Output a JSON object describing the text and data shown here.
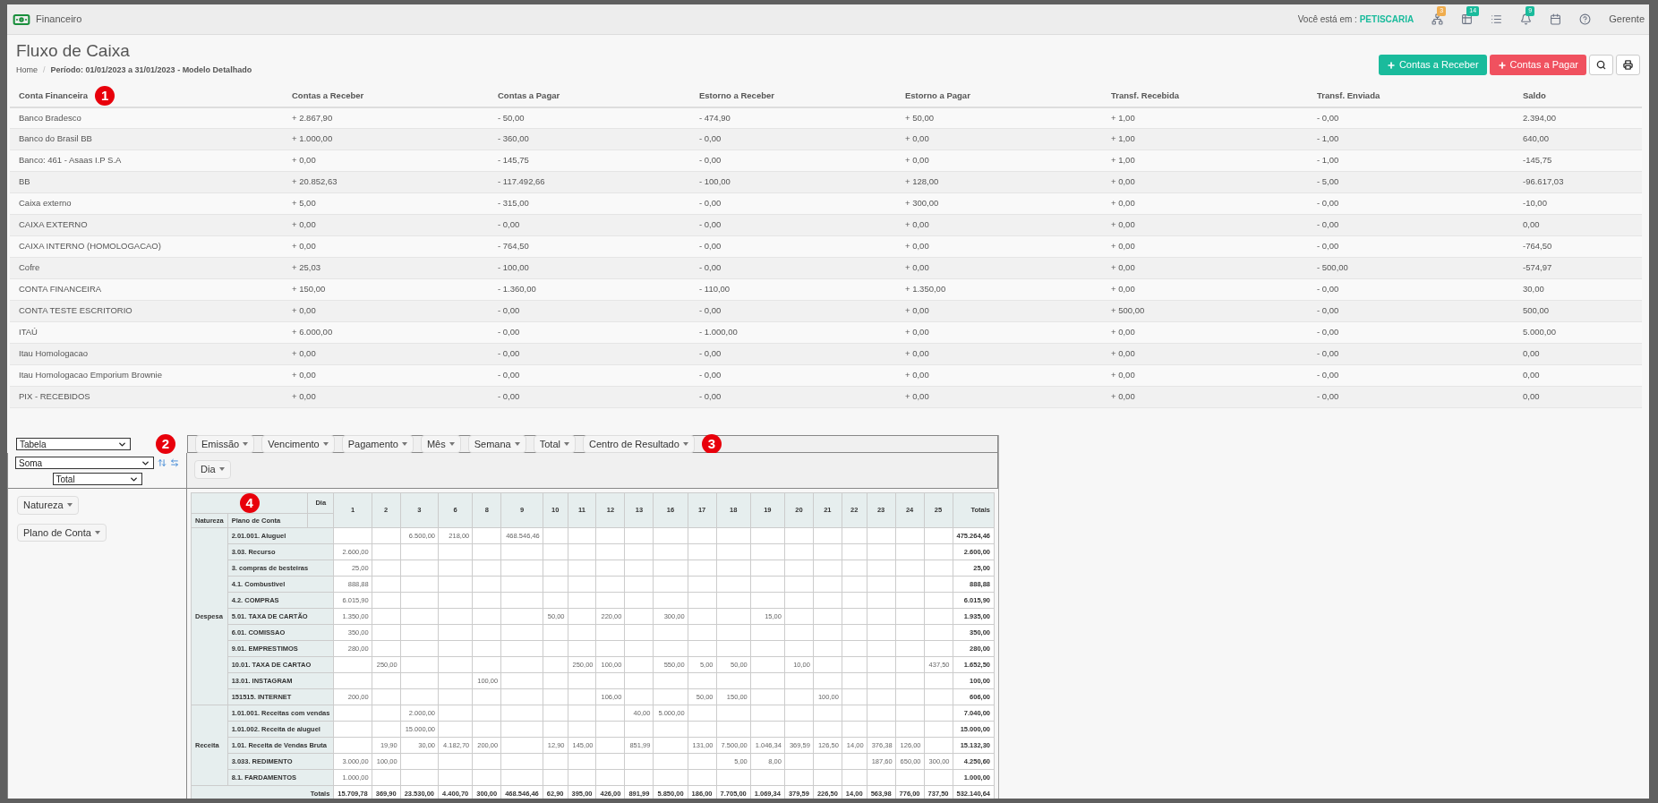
{
  "app_bar": {
    "module": "Financeiro",
    "location_label": "Você está em :",
    "location": "PETISCARIA",
    "icons": [
      {
        "kind": "sitemap",
        "badge": "3",
        "color": "#f0ad4e"
      },
      {
        "kind": "table",
        "badge": "14",
        "color": "#1abb9c"
      },
      {
        "kind": "list"
      },
      {
        "kind": "bell",
        "badge": "9",
        "color": "#1abb9c"
      },
      {
        "kind": "calendar"
      },
      {
        "kind": "help"
      }
    ],
    "user": "Gerente"
  },
  "page": {
    "title": "Fluxo de Caixa",
    "breadcrumb": {
      "home": "Home",
      "separator": "/",
      "current": "Período: 01/01/2023 a 31/01/2023 - Modelo Detalhado"
    },
    "buttons": [
      {
        "kind": "receive",
        "label": "Contas a Receber"
      },
      {
        "kind": "pay",
        "label": "Contas a Pagar"
      },
      {
        "kind": "search"
      },
      {
        "kind": "print"
      }
    ]
  },
  "markers": [
    "1",
    "2",
    "3",
    "4"
  ],
  "summary_table": {
    "columns": [
      "Conta Financeira",
      "Contas a Receber",
      "Contas a Pagar",
      "Estorno a Receber",
      "Estorno a Pagar",
      "Transf. Recebida",
      "Transf. Enviada",
      "Saldo"
    ],
    "rows": [
      [
        "Banco Bradesco",
        "+ 2.867,90",
        "- 50,00",
        "- 474,90",
        "+ 50,00",
        "+ 1,00",
        "- 0,00",
        "2.394,00"
      ],
      [
        "Banco do Brasil BB",
        "+ 1.000,00",
        "- 360,00",
        "- 0,00",
        "+ 0,00",
        "+ 1,00",
        "- 1,00",
        "640,00"
      ],
      [
        "Banco: 461 - Asaas I.P S.A",
        "+ 0,00",
        "- 145,75",
        "- 0,00",
        "+ 0,00",
        "+ 1,00",
        "- 1,00",
        "-145,75"
      ],
      [
        "BB",
        "+ 20.852,63",
        "- 117.492,66",
        "- 100,00",
        "+ 128,00",
        "+ 0,00",
        "- 5,00",
        "-96.617,03"
      ],
      [
        "Caixa externo",
        "+ 5,00",
        "- 315,00",
        "- 0,00",
        "+ 300,00",
        "+ 0,00",
        "- 0,00",
        "-10,00"
      ],
      [
        "CAIXA EXTERNO",
        "+ 0,00",
        "- 0,00",
        "- 0,00",
        "+ 0,00",
        "+ 0,00",
        "- 0,00",
        "0,00"
      ],
      [
        "CAIXA INTERNO (HOMOLOGACAO)",
        "+ 0,00",
        "- 764,50",
        "- 0,00",
        "+ 0,00",
        "+ 0,00",
        "- 0,00",
        "-764,50"
      ],
      [
        "Cofre",
        "+ 25,03",
        "- 100,00",
        "- 0,00",
        "+ 0,00",
        "+ 0,00",
        "- 500,00",
        "-574,97"
      ],
      [
        "CONTA FINANCEIRA",
        "+ 150,00",
        "- 1.360,00",
        "- 110,00",
        "+ 1.350,00",
        "+ 0,00",
        "- 0,00",
        "30,00"
      ],
      [
        "CONTA TESTE ESCRITORIO",
        "+ 0,00",
        "- 0,00",
        "- 0,00",
        "+ 0,00",
        "+ 500,00",
        "- 0,00",
        "500,00"
      ],
      [
        "ITAÚ",
        "+ 6.000,00",
        "- 0,00",
        "- 1.000,00",
        "+ 0,00",
        "+ 0,00",
        "- 0,00",
        "5.000,00"
      ],
      [
        "Itau Homologacao",
        "+ 0,00",
        "- 0,00",
        "- 0,00",
        "+ 0,00",
        "+ 0,00",
        "- 0,00",
        "0,00"
      ],
      [
        "Itau Homologacao Emporium Brownie",
        "+ 0,00",
        "- 0,00",
        "- 0,00",
        "+ 0,00",
        "+ 0,00",
        "- 0,00",
        "0,00"
      ],
      [
        "PIX - RECEBIDOS",
        "+ 0,00",
        "- 0,00",
        "- 0,00",
        "+ 0,00",
        "+ 0,00",
        "- 0,00",
        "0,00"
      ]
    ]
  },
  "pivot": {
    "renderer": "Tabela",
    "aggregator": "Soma",
    "value_field": "Total",
    "unused_fields": [
      "Emissão",
      "Vencimento",
      "Pagamento",
      "Mês",
      "Semana",
      "Total",
      "Centro de Resultado"
    ],
    "col_fields": [
      "Dia"
    ],
    "row_fields": [
      "Natureza",
      "Plano de Conta"
    ],
    "table": {
      "col_attr": "Dia",
      "row_attrs": [
        "Natureza",
        "Plano de Conta"
      ],
      "totals_header": "Totals",
      "columns": [
        "1",
        "2",
        "3",
        "6",
        "8",
        "9",
        "10",
        "11",
        "12",
        "13",
        "16",
        "17",
        "18",
        "19",
        "20",
        "21",
        "22",
        "23",
        "24",
        "25"
      ],
      "groups": [
        {
          "label": "Despesa",
          "rows": [
            {
              "label": "2.01.001. Aluguel",
              "cells": [
                {
                  "empty": true
                },
                {
                  "empty": true
                },
                {
                  "value": "6.500,00"
                },
                {
                  "value": "218,00"
                },
                {
                  "empty": true
                },
                {
                  "value": "468.546,46"
                },
                {
                  "empty": true
                },
                {
                  "empty": true
                },
                {
                  "empty": true
                },
                {
                  "empty": true
                },
                {
                  "empty": true
                },
                {
                  "empty": true
                },
                {
                  "empty": true
                },
                {
                  "empty": true
                },
                {
                  "empty": true
                },
                {
                  "empty": true
                },
                {
                  "empty": true
                },
                {
                  "empty": true
                },
                {
                  "empty": true
                },
                {
                  "empty": true
                }
              ],
              "total": "475.264,46"
            },
            {
              "label": "3.03. Recurso",
              "cells": [
                {
                  "value": "2.600,00"
                },
                {
                  "empty": true
                },
                {
                  "empty": true
                },
                {
                  "empty": true
                },
                {
                  "empty": true
                },
                {
                  "empty": true
                },
                {
                  "empty": true
                },
                {
                  "empty": true
                },
                {
                  "empty": true
                },
                {
                  "empty": true
                },
                {
                  "empty": true
                },
                {
                  "empty": true
                },
                {
                  "empty": true
                },
                {
                  "empty": true
                },
                {
                  "empty": true
                },
                {
                  "empty": true
                },
                {
                  "empty": true
                },
                {
                  "empty": true
                },
                {
                  "empty": true
                },
                {
                  "empty": true
                }
              ],
              "total": "2.600,00"
            },
            {
              "label": "3. compras de besteiras",
              "cells": [
                {
                  "value": "25,00"
                },
                {
                  "empty": true
                },
                {
                  "empty": true
                },
                {
                  "empty": true
                },
                {
                  "empty": true
                },
                {
                  "empty": true
                },
                {
                  "empty": true
                },
                {
                  "empty": true
                },
                {
                  "empty": true
                },
                {
                  "empty": true
                },
                {
                  "empty": true
                },
                {
                  "empty": true
                },
                {
                  "empty": true
                },
                {
                  "empty": true
                },
                {
                  "empty": true
                },
                {
                  "empty": true
                },
                {
                  "empty": true
                },
                {
                  "empty": true
                },
                {
                  "empty": true
                },
                {
                  "empty": true
                }
              ],
              "total": "25,00"
            },
            {
              "label": "4.1. Combustivel",
              "cells": [
                {
                  "value": "888,88"
                },
                {
                  "empty": true
                },
                {
                  "empty": true
                },
                {
                  "empty": true
                },
                {
                  "empty": true
                },
                {
                  "empty": true
                },
                {
                  "empty": true
                },
                {
                  "empty": true
                },
                {
                  "empty": true
                },
                {
                  "empty": true
                },
                {
                  "empty": true
                },
                {
                  "empty": true
                },
                {
                  "empty": true
                },
                {
                  "empty": true
                },
                {
                  "empty": true
                },
                {
                  "empty": true
                },
                {
                  "empty": true
                },
                {
                  "empty": true
                },
                {
                  "empty": true
                },
                {
                  "empty": true
                }
              ],
              "total": "888,88"
            },
            {
              "label": "4.2. COMPRAS",
              "cells": [
                {
                  "value": "6.015,90"
                },
                {
                  "empty": true
                },
                {
                  "empty": true
                },
                {
                  "empty": true
                },
                {
                  "empty": true
                },
                {
                  "empty": true
                },
                {
                  "empty": true
                },
                {
                  "empty": true
                },
                {
                  "empty": true
                },
                {
                  "empty": true
                },
                {
                  "empty": true
                },
                {
                  "empty": true
                },
                {
                  "empty": true
                },
                {
                  "empty": true
                },
                {
                  "empty": true
                },
                {
                  "empty": true
                },
                {
                  "empty": true
                },
                {
                  "empty": true
                },
                {
                  "empty": true
                },
                {
                  "empty": true
                }
              ],
              "total": "6.015,90"
            },
            {
              "label": "5.01. TAXA DE CARTÃO",
              "cells": [
                {
                  "value": "1.350,00"
                },
                {
                  "empty": true
                },
                {
                  "empty": true
                },
                {
                  "empty": true
                },
                {
                  "empty": true
                },
                {
                  "empty": true
                },
                {
                  "value": "50,00"
                },
                {
                  "empty": true
                },
                {
                  "value": "220,00"
                },
                {
                  "empty": true
                },
                {
                  "value": "300,00"
                },
                {
                  "empty": true
                },
                {
                  "empty": true
                },
                {
                  "value": "15,00"
                },
                {
                  "empty": true
                },
                {
                  "empty": true
                },
                {
                  "empty": true
                },
                {
                  "empty": true
                },
                {
                  "empty": true
                },
                {
                  "empty": true
                }
              ],
              "total": "1.935,00"
            },
            {
              "label": "6.01. COMISSAO",
              "cells": [
                {
                  "value": "350,00"
                },
                {
                  "empty": true
                },
                {
                  "empty": true
                },
                {
                  "empty": true
                },
                {
                  "empty": true
                },
                {
                  "empty": true
                },
                {
                  "empty": true
                },
                {
                  "empty": true
                },
                {
                  "empty": true
                },
                {
                  "empty": true
                },
                {
                  "empty": true
                },
                {
                  "empty": true
                },
                {
                  "empty": true
                },
                {
                  "empty": true
                },
                {
                  "empty": true
                },
                {
                  "empty": true
                },
                {
                  "empty": true
                },
                {
                  "empty": true
                },
                {
                  "empty": true
                },
                {
                  "empty": true
                }
              ],
              "total": "350,00"
            },
            {
              "label": "9.01. EMPRESTIMOS",
              "cells": [
                {
                  "value": "280,00"
                },
                {
                  "empty": true
                },
                {
                  "empty": true
                },
                {
                  "empty": true
                },
                {
                  "empty": true
                },
                {
                  "empty": true
                },
                {
                  "empty": true
                },
                {
                  "empty": true
                },
                {
                  "empty": true
                },
                {
                  "empty": true
                },
                {
                  "empty": true
                },
                {
                  "empty": true
                },
                {
                  "empty": true
                },
                {
                  "empty": true
                },
                {
                  "empty": true
                },
                {
                  "empty": true
                },
                {
                  "empty": true
                },
                {
                  "empty": true
                },
                {
                  "empty": true
                },
                {
                  "empty": true
                }
              ],
              "total": "280,00"
            },
            {
              "label": "10.01. TAXA DE CARTAO",
              "cells": [
                {
                  "empty": true
                },
                {
                  "value": "250,00"
                },
                {
                  "empty": true
                },
                {
                  "empty": true
                },
                {
                  "empty": true
                },
                {
                  "empty": true
                },
                {
                  "empty": true
                },
                {
                  "value": "250,00"
                },
                {
                  "value": "100,00"
                },
                {
                  "empty": true
                },
                {
                  "value": "550,00"
                },
                {
                  "value": "5,00"
                },
                {
                  "value": "50,00"
                },
                {
                  "empty": true
                },
                {
                  "value": "10,00"
                },
                {
                  "empty": true
                },
                {
                  "empty": true
                },
                {
                  "empty": true
                },
                {
                  "empty": true
                },
                {
                  "value": "437,50"
                }
              ],
              "total": "1.652,50"
            },
            {
              "label": "13.01. INSTAGRAM",
              "cells": [
                {
                  "empty": true
                },
                {
                  "empty": true
                },
                {
                  "empty": true
                },
                {
                  "empty": true
                },
                {
                  "value": "100,00"
                },
                {
                  "empty": true
                },
                {
                  "empty": true
                },
                {
                  "empty": true
                },
                {
                  "empty": true
                },
                {
                  "empty": true
                },
                {
                  "empty": true
                },
                {
                  "empty": true
                },
                {
                  "empty": true
                },
                {
                  "empty": true
                },
                {
                  "empty": true
                },
                {
                  "empty": true
                },
                {
                  "empty": true
                },
                {
                  "empty": true
                },
                {
                  "empty": true
                },
                {
                  "empty": true
                }
              ],
              "total": "100,00"
            },
            {
              "label": "151515. INTERNET",
              "cells": [
                {
                  "value": "200,00"
                },
                {
                  "empty": true
                },
                {
                  "empty": true
                },
                {
                  "empty": true
                },
                {
                  "empty": true
                },
                {
                  "empty": true
                },
                {
                  "empty": true
                },
                {
                  "empty": true
                },
                {
                  "value": "106,00"
                },
                {
                  "empty": true
                },
                {
                  "empty": true
                },
                {
                  "value": "50,00"
                },
                {
                  "value": "150,00"
                },
                {
                  "empty": true
                },
                {
                  "empty": true
                },
                {
                  "value": "100,00"
                },
                {
                  "empty": true
                },
                {
                  "empty": true
                },
                {
                  "empty": true
                },
                {
                  "empty": true
                }
              ],
              "total": "606,00"
            }
          ]
        },
        {
          "label": "Receita",
          "rows": [
            {
              "label": "1.01.001. Receitas com vendas",
              "cells": [
                {
                  "empty": true
                },
                {
                  "empty": true
                },
                {
                  "value": "2.000,00"
                },
                {
                  "empty": true
                },
                {
                  "empty": true
                },
                {
                  "empty": true
                },
                {
                  "empty": true
                },
                {
                  "empty": true
                },
                {
                  "empty": true
                },
                {
                  "value": "40,00"
                },
                {
                  "value": "5.000,00"
                },
                {
                  "empty": true
                },
                {
                  "empty": true
                },
                {
                  "empty": true
                },
                {
                  "empty": true
                },
                {
                  "empty": true
                },
                {
                  "empty": true
                },
                {
                  "empty": true
                },
                {
                  "empty": true
                },
                {
                  "empty": true
                }
              ],
              "total": "7.040,00"
            },
            {
              "label": "1.01.002. Receita de aluguel",
              "cells": [
                {
                  "empty": true
                },
                {
                  "empty": true
                },
                {
                  "value": "15.000,00"
                },
                {
                  "empty": true
                },
                {
                  "empty": true
                },
                {
                  "empty": true
                },
                {
                  "empty": true
                },
                {
                  "empty": true
                },
                {
                  "empty": true
                },
                {
                  "empty": true
                },
                {
                  "empty": true
                },
                {
                  "empty": true
                },
                {
                  "empty": true
                },
                {
                  "empty": true
                },
                {
                  "empty": true
                },
                {
                  "empty": true
                },
                {
                  "empty": true
                },
                {
                  "empty": true
                },
                {
                  "empty": true
                },
                {
                  "empty": true
                }
              ],
              "total": "15.000,00"
            },
            {
              "label": "1.01. Receita de Vendas Bruta",
              "cells": [
                {
                  "empty": true
                },
                {
                  "value": "19,90"
                },
                {
                  "value": "30,00"
                },
                {
                  "value": "4.182,70"
                },
                {
                  "value": "200,00"
                },
                {
                  "empty": true
                },
                {
                  "value": "12,90"
                },
                {
                  "value": "145,00"
                },
                {
                  "empty": true
                },
                {
                  "value": "851,99"
                },
                {
                  "empty": true
                },
                {
                  "value": "131,00"
                },
                {
                  "value": "7.500,00"
                },
                {
                  "value": "1.046,34"
                },
                {
                  "value": "369,59"
                },
                {
                  "value": "126,50"
                },
                {
                  "value": "14,00"
                },
                {
                  "value": "376,38"
                },
                {
                  "value": "126,00"
                },
                {
                  "empty": true
                }
              ],
              "total": "15.132,30"
            },
            {
              "label": "3.033. REDIMENTO",
              "cells": [
                {
                  "value": "3.000,00"
                },
                {
                  "value": "100,00"
                },
                {
                  "empty": true
                },
                {
                  "empty": true
                },
                {
                  "empty": true
                },
                {
                  "empty": true
                },
                {
                  "empty": true
                },
                {
                  "empty": true
                },
                {
                  "empty": true
                },
                {
                  "empty": true
                },
                {
                  "empty": true
                },
                {
                  "empty": true
                },
                {
                  "value": "5,00"
                },
                {
                  "value": "8,00"
                },
                {
                  "empty": true
                },
                {
                  "empty": true
                },
                {
                  "empty": true
                },
                {
                  "value": "187,60"
                },
                {
                  "value": "650,00"
                },
                {
                  "value": "300,00"
                }
              ],
              "total": "4.250,60"
            },
            {
              "label": "8.1. FARDAMENTOS",
              "cells": [
                {
                  "value": "1.000,00"
                },
                {
                  "empty": true
                },
                {
                  "empty": true
                },
                {
                  "empty": true
                },
                {
                  "empty": true
                },
                {
                  "empty": true
                },
                {
                  "empty": true
                },
                {
                  "empty": true
                },
                {
                  "empty": true
                },
                {
                  "empty": true
                },
                {
                  "empty": true
                },
                {
                  "empty": true
                },
                {
                  "empty": true
                },
                {
                  "empty": true
                },
                {
                  "empty": true
                },
                {
                  "empty": true
                },
                {
                  "empty": true
                },
                {
                  "empty": true
                },
                {
                  "empty": true
                },
                {
                  "empty": true
                }
              ],
              "total": "1.000,00"
            }
          ]
        }
      ],
      "totals": {
        "label": "Totals",
        "values": [
          "15.709,78",
          "369,90",
          "23.530,00",
          "4.400,70",
          "300,00",
          "468.546,46",
          "62,90",
          "395,00",
          "426,00",
          "891,99",
          "5.850,00",
          "186,00",
          "7.705,00",
          "1.069,34",
          "379,59",
          "226,50",
          "14,00",
          "563,98",
          "776,00",
          "737,50"
        ],
        "total": "532.140,64"
      }
    }
  }
}
